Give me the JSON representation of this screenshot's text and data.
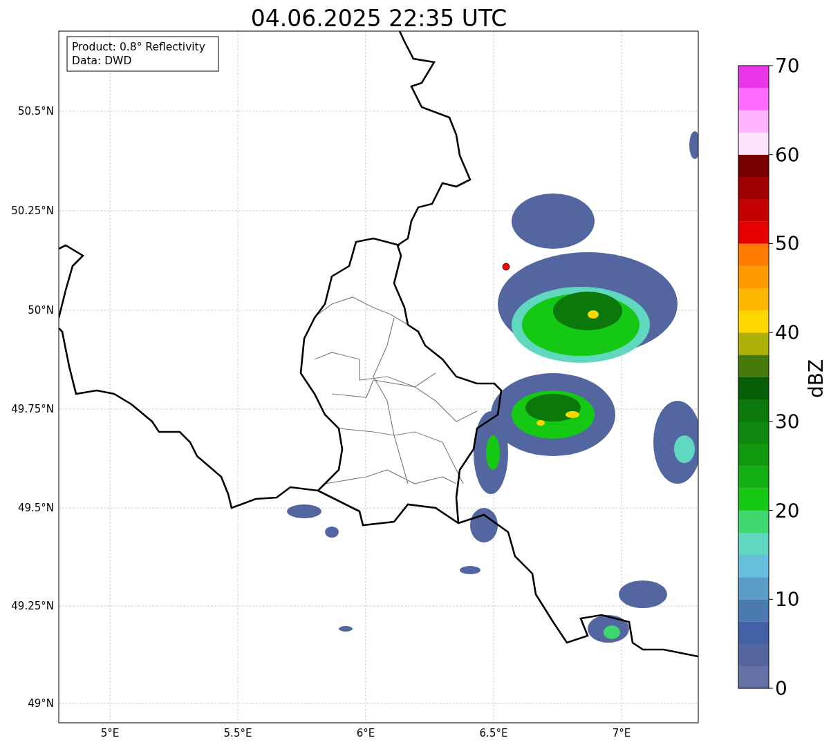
{
  "title": "04.06.2025 22:35 UTC",
  "info_box": [
    "Product: 0.8° Reflectivity",
    "Data: DWD"
  ],
  "lat_ticks": [
    "50.5°N",
    "50.25°N",
    "50°N",
    "49.75°N",
    "49.5°N",
    "49.25°N",
    "49°N"
  ],
  "lon_ticks": [
    "5°E",
    "5.5°E",
    "6°E",
    "6.5°E",
    "7°E"
  ],
  "colorbar": {
    "label": "dBZ",
    "ticks": [
      "70",
      "60",
      "50",
      "40",
      "30",
      "20",
      "10",
      "0"
    ]
  }
}
